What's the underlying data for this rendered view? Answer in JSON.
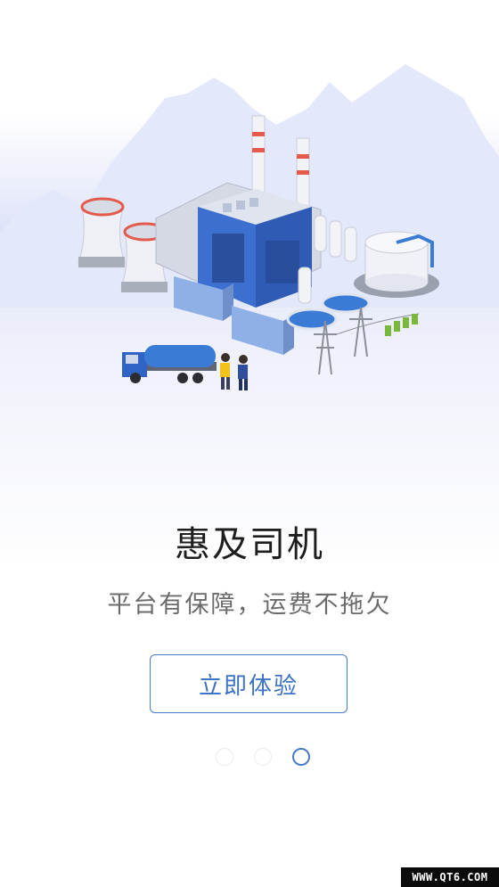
{
  "onboarding": {
    "title": "惠及司机",
    "subtitle": "平台有保障，运费不拖欠",
    "cta_label": "立即体验",
    "page_indicator": {
      "total": 3,
      "active_index": 3
    }
  },
  "watermark": {
    "text": "WWW.QT6.COM"
  },
  "colors": {
    "accent": "#4a7bc8",
    "title_text": "#1e1e1e",
    "subtitle_text": "#6b6b6b",
    "building_blue": "#3d6fd0",
    "tank_blue": "#3a7bd5"
  },
  "illustration": {
    "subject": "industrial-plant-illustration",
    "elements": [
      "cooling-tower",
      "factory-building",
      "chimney",
      "storage-tank",
      "power-pylon",
      "tanker-truck",
      "handshake-people",
      "water-treatment-pools"
    ]
  }
}
